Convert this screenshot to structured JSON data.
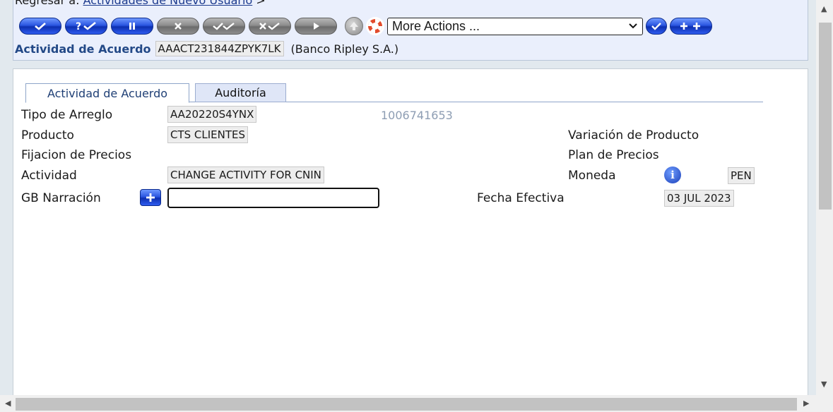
{
  "breadcrumb": {
    "prefix": "Regresar a:",
    "link": "Actividades de Nuevo Usuario",
    "suffix": ">"
  },
  "toolbar": {
    "buttons": [
      {
        "name": "commit-button",
        "icon": "check-icon",
        "color": "blue"
      },
      {
        "name": "validate-button",
        "icon": "question-check-icon",
        "color": "blue"
      },
      {
        "name": "hold-button",
        "icon": "pause-icon",
        "color": "blue"
      },
      {
        "name": "delete-button",
        "icon": "x-icon",
        "color": "gray"
      },
      {
        "name": "authorise-button",
        "icon": "double-check-icon",
        "color": "gray"
      },
      {
        "name": "reverse-button",
        "icon": "x-check-icon",
        "color": "gray"
      },
      {
        "name": "next-button",
        "icon": "play-icon",
        "color": "gray"
      }
    ],
    "more_actions": "More Actions ...",
    "accent_blue": "#2a55e0",
    "accent_gray": "#8d8d8d"
  },
  "header": {
    "label": "Actividad de Acuerdo",
    "id": "AAACT231844ZPYK7LK",
    "company": "(Banco Ripley S.A.)"
  },
  "tabs": [
    {
      "label": "Actividad de Acuerdo"
    },
    {
      "label": "Auditoría"
    }
  ],
  "form": {
    "tipo_label": "Tipo de Arreglo",
    "tipo_value": "AA20220S4YNX",
    "tipo_extra": "1006741653",
    "producto_label": "Producto",
    "producto_value": "CTS CLIENTES",
    "variacion_label": "Variación de Producto",
    "fijacion_label": "Fijacion de Precios",
    "plan_label": "Plan de Precios",
    "actividad_label": "Actividad",
    "actividad_value": "CHANGE ACTIVITY FOR CNIN",
    "moneda_label": "Moneda",
    "moneda_value": "PEN",
    "narracion_label": "GB Narración",
    "narracion_value": "",
    "fecha_label": "Fecha Efectiva",
    "fecha_value": "03 JUL 2023"
  }
}
